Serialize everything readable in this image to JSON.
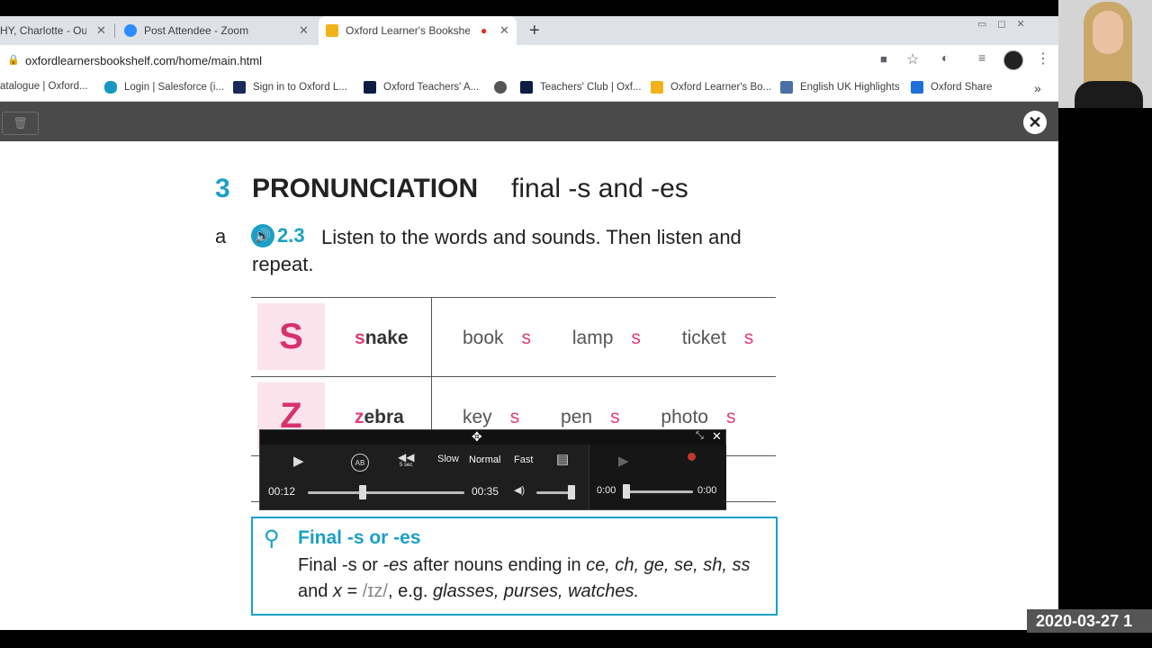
{
  "browser": {
    "tabs": [
      {
        "label": "HY, Charlotte - Outlo",
        "close": "✕"
      },
      {
        "label": "Post Attendee - Zoom",
        "close": "✕"
      },
      {
        "label": "Oxford Learner's Bookshelf |",
        "close": "✕",
        "recording": "●"
      }
    ],
    "new_tab": "+",
    "url": "oxfordlearnersbookshelf.com/home/main.html",
    "bookmarks": [
      {
        "label": "atalogue | Oxford...",
        "color": "#888888"
      },
      {
        "label": "Login | Salesforce (i...",
        "color": "#1798c1"
      },
      {
        "label": "Sign in to Oxford L...",
        "color": "#1c2a59"
      },
      {
        "label": "Oxford Teachers' A...",
        "color": "#0c1d44"
      },
      {
        "label": "",
        "color": "#555555"
      },
      {
        "label": "Teachers' Club | Oxf...",
        "color": "#0c1d44"
      },
      {
        "label": "Oxford Learner's Bo...",
        "color": "#f2b21a"
      },
      {
        "label": "English UK Highlights",
        "color": "#4a6fa5"
      },
      {
        "label": "Oxford Share",
        "color": "#1e6fd9"
      }
    ],
    "more": "»"
  },
  "app": {
    "trash_icon": "🗑",
    "close_icon": "✕"
  },
  "page": {
    "section_number": "3",
    "section_title": "PRONUNCIATION",
    "section_subtitle": "final -s and -es",
    "exercise_letter": "a",
    "track": "2.3",
    "instruction": "Listen to the words and sounds. Then listen and repeat.",
    "rows": [
      {
        "sound": "snake",
        "picture": "S",
        "examples": [
          {
            "stem": "book",
            "end": "s"
          },
          {
            "stem": "lamp",
            "end": "s"
          },
          {
            "stem": "ticket",
            "end": "s"
          }
        ]
      },
      {
        "sound": "zebra",
        "picture": "Z",
        "examples": [
          {
            "stem": "key",
            "end": "s"
          },
          {
            "stem": "pen",
            "end": "s"
          },
          {
            "stem": "photo",
            "end": "s"
          }
        ]
      }
    ],
    "tip": {
      "title": "Final -s or -es",
      "line1_pre": "Final -s or ",
      "line1_italic": "-es",
      "line1_post": " after nouns ending in ",
      "endings": "ce, ch, ge, se,",
      "line2_italic": "sh, ss",
      "line2_and": " and ",
      "x": "x",
      "eq": " = ",
      "ipa": "/ɪz/",
      "eg": ", e.g. ",
      "examples": "glasses, purses, watches."
    }
  },
  "player": {
    "elapsed": "00:12",
    "total": "00:35",
    "progress": 0.35,
    "speed_slow": "Slow",
    "speed_normal": "Normal",
    "speed_fast": "Fast",
    "skip_label": "5 sec",
    "ab_label": "AB",
    "rec_start": "0:00",
    "rec_end": "0:00"
  },
  "overlay": {
    "timestamp": "2020-03-27 1"
  }
}
